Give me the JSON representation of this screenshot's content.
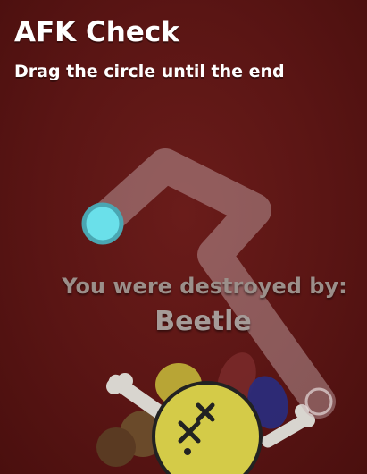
{
  "afk_check": {
    "title": "AFK Check",
    "instruction": "Drag the circle until the end"
  },
  "death_screen": {
    "label": "You were destroyed by:",
    "killer": "Beetle"
  },
  "colors": {
    "background": "#5a1514",
    "path": "#a0787a",
    "handle": "#66dde6",
    "handle_border": "#4aa6b2"
  },
  "icons": {
    "character": "dead-flower-icon",
    "bones": "crossed-bones-icon"
  }
}
